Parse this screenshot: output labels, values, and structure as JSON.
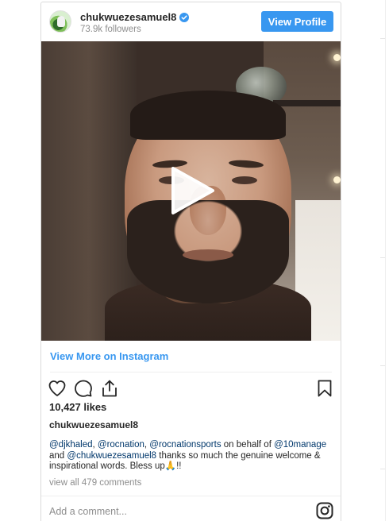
{
  "post": {
    "username": "chukwuezesamuel8",
    "followers": "73.9k followers",
    "view_profile_label": "View Profile",
    "view_more_label": "View More on Instagram",
    "likes": "10,427 likes",
    "caption_user": "chukwuezesamuel8",
    "caption": {
      "mention1": "@djkhaled",
      "sep1": ", ",
      "mention2": "@rocnation",
      "sep2": ", ",
      "mention3": "@rocnationsports",
      "text1": " on behalf of ",
      "mention4": "@10manage",
      "text2": " and ",
      "mention5": "@chukwuezesamuel8",
      "text3": " thanks so much the genuine welcome & inspirational words. Bless up",
      "emoji": "🙏",
      "text4": "!!"
    },
    "view_comments": "view all 479 comments",
    "add_comment_placeholder": "Add a comment..."
  },
  "colors": {
    "button_blue": "#3897f0",
    "mention_blue": "#00376b",
    "muted_gray": "#8e8e8e",
    "border": "#dbdbdb"
  },
  "icons": {
    "verified": "verified-badge-icon",
    "play": "play-icon",
    "like": "heart-icon",
    "comment": "comment-bubble-icon",
    "share": "share-upload-icon",
    "save": "bookmark-icon",
    "instagram": "instagram-glyph-icon"
  }
}
